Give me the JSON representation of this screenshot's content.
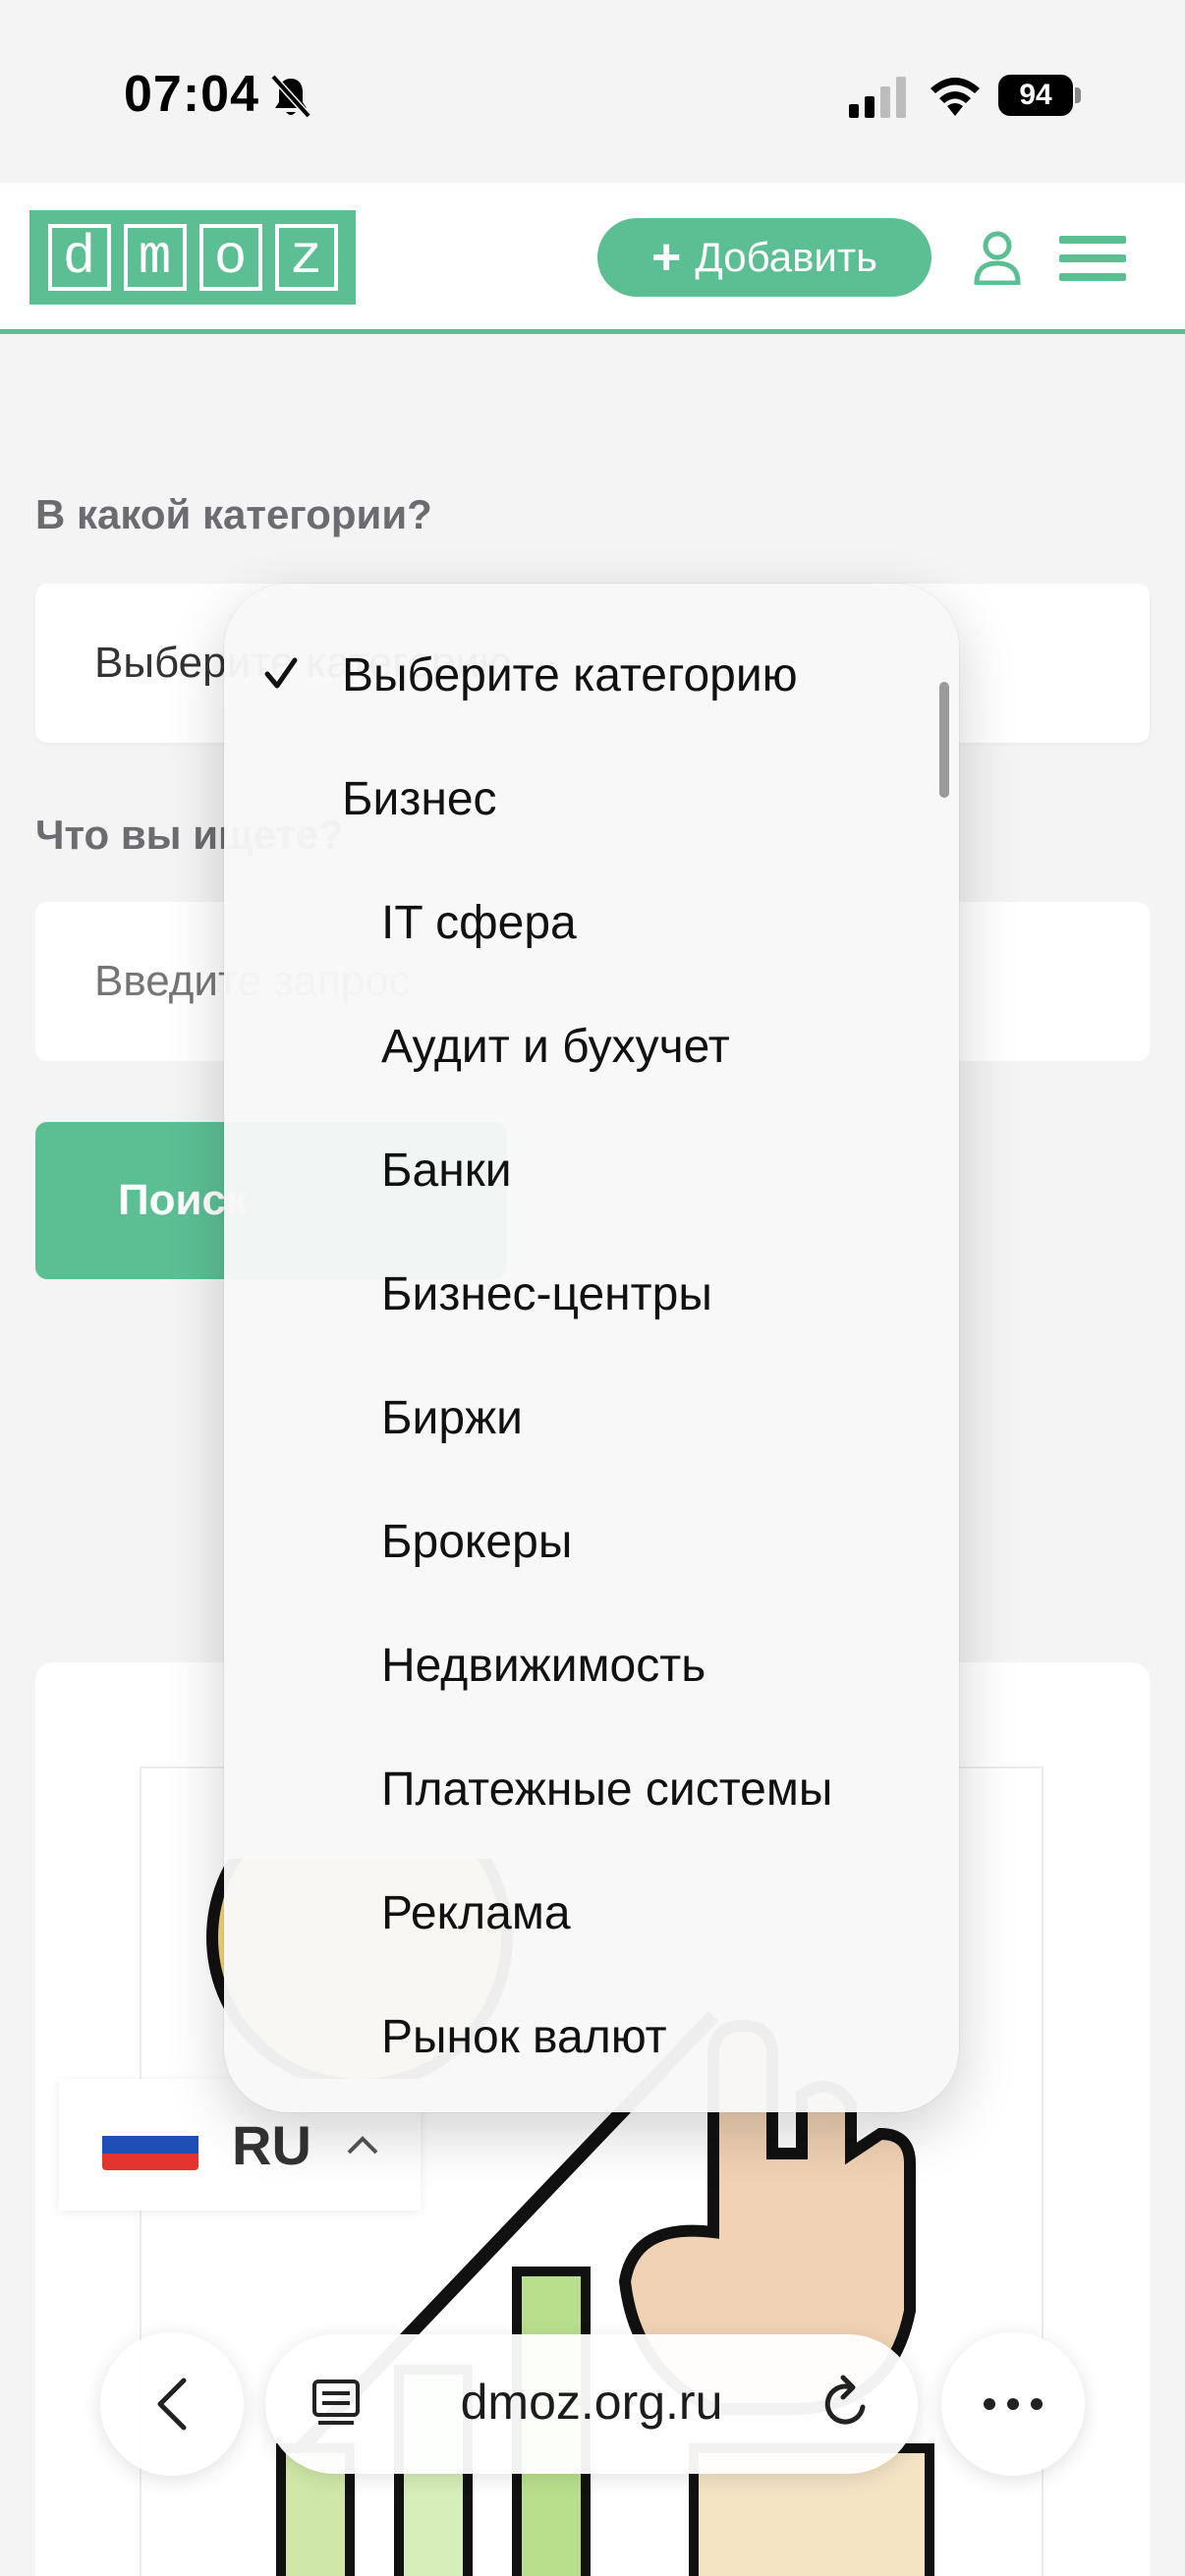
{
  "status_bar": {
    "time": "07:04",
    "battery": "94"
  },
  "header": {
    "logo_letters": [
      "d",
      "m",
      "o",
      "z"
    ],
    "add_button_label": "Добавить"
  },
  "form": {
    "category_label": "В какой категории?",
    "category_value": "Выберите категорию",
    "query_label": "Что вы ищете?",
    "query_placeholder": "Введите запрос",
    "search_button_label": "Поиск"
  },
  "dropdown": {
    "selected": "Выберите категорию",
    "options": [
      {
        "label": "Выберите категорию",
        "level": 0,
        "checked": true
      },
      {
        "label": "Бизнес",
        "level": 0,
        "checked": false
      },
      {
        "label": "IT сфера",
        "level": 1,
        "checked": false
      },
      {
        "label": "Аудит и бухучет",
        "level": 1,
        "checked": false
      },
      {
        "label": "Банки",
        "level": 1,
        "checked": false
      },
      {
        "label": "Бизнес-центры",
        "level": 1,
        "checked": false
      },
      {
        "label": "Биржи",
        "level": 1,
        "checked": false
      },
      {
        "label": "Брокеры",
        "level": 1,
        "checked": false
      },
      {
        "label": "Недвижимость",
        "level": 1,
        "checked": false
      },
      {
        "label": "Платежные системы",
        "level": 1,
        "checked": false
      },
      {
        "label": "Реклама",
        "level": 1,
        "checked": false
      },
      {
        "label": "Рынок валют",
        "level": 1,
        "checked": false
      }
    ]
  },
  "language": {
    "code": "RU"
  },
  "browser": {
    "url": "dmoz.org.ru"
  },
  "colors": {
    "accent": "#5cbf94",
    "background": "#f4f4f4"
  }
}
